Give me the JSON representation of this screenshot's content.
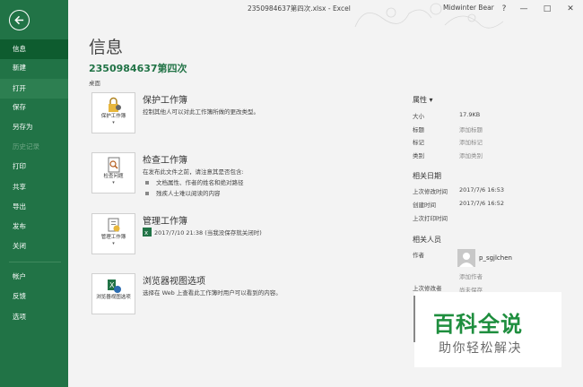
{
  "window": {
    "title": "2350984637第四次.xlsx - Excel",
    "user": "Midwinter Bear",
    "help": "?",
    "minimize": "—",
    "restore": "□",
    "close": "✕"
  },
  "nav": {
    "items": [
      {
        "label": "信息"
      },
      {
        "label": "新建"
      },
      {
        "label": "打开"
      },
      {
        "label": "保存"
      },
      {
        "label": "另存为"
      },
      {
        "label": "历史记录"
      },
      {
        "label": "打印"
      },
      {
        "label": "共享"
      },
      {
        "label": "导出"
      },
      {
        "label": "发布"
      },
      {
        "label": "关闭"
      },
      {
        "label": "帐户"
      },
      {
        "label": "反馈"
      },
      {
        "label": "选项"
      }
    ]
  },
  "page": {
    "title": "信息",
    "doc_name": "2350984637第四次",
    "doc_location": "桌面"
  },
  "sections": {
    "protect": {
      "button_label": "保护工作簿",
      "title": "保护工作簿",
      "desc": "控制其他人可以对此工作簿所做的更改类型。"
    },
    "inspect": {
      "button_label": "检查问题",
      "title": "检查工作簿",
      "desc": "在发布此文件之前，请注意其是否包含:",
      "bullets": [
        "文档属性、作者的姓名和绝对路径",
        "残疾人士难以阅读的内容"
      ]
    },
    "manage": {
      "button_label": "管理工作簿",
      "title": "管理工作簿",
      "entry": "2017/7/10 21:38 (当我没保存就关闭时)"
    },
    "browser": {
      "button_label": "浏览器视图选项",
      "title": "浏览器视图选项",
      "desc": "选择在 Web 上查看此工作簿时用户可以看到的内容。"
    }
  },
  "properties": {
    "header": "属性 ▾",
    "size_label": "大小",
    "size_value": "17.9KB",
    "title_label": "标题",
    "title_value": "添加标题",
    "tags_label": "标记",
    "tags_value": "添加标记",
    "category_label": "类别",
    "category_value": "添加类别",
    "dates_header": "相关日期",
    "modified_label": "上次修改时间",
    "modified_value": "2017/7/6 16:53",
    "created_label": "创建时间",
    "created_value": "2017/7/6 16:52",
    "printed_label": "上次打印时间",
    "people_header": "相关人员",
    "author_label": "作者",
    "author_name": "p_sgjlchen",
    "add_author": "添加作者",
    "last_modified_by_label": "上次修改者",
    "last_modified_by_value": "尚未保存"
  },
  "watermark": {
    "main": "百科全说",
    "sub": "助你轻松解决"
  }
}
